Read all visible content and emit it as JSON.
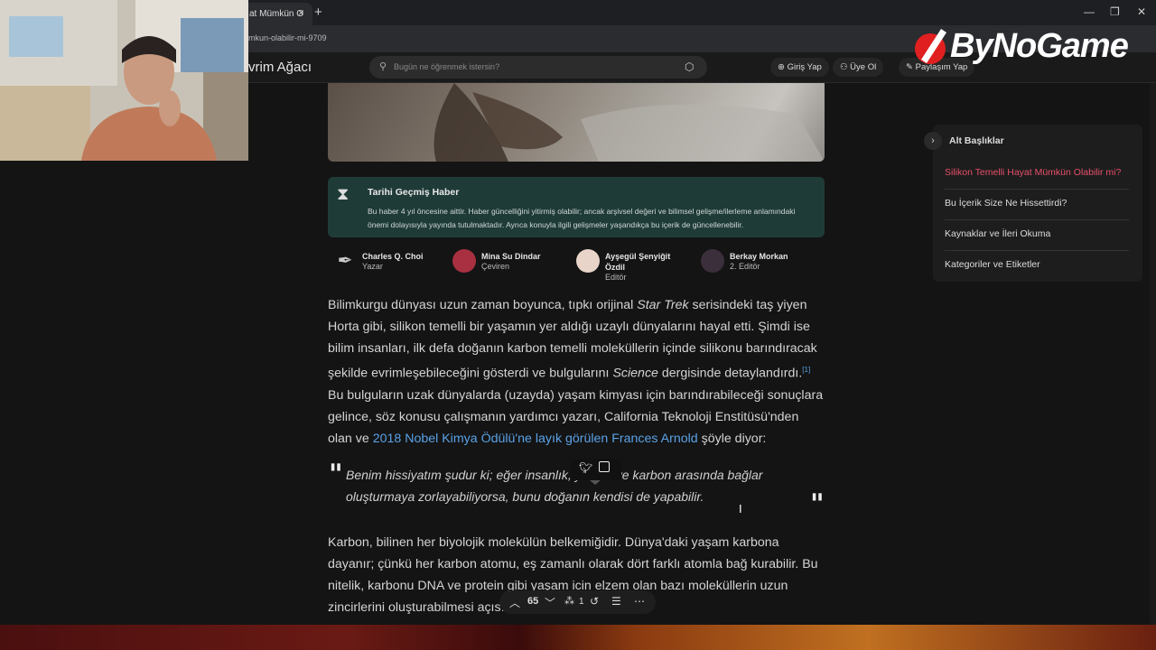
{
  "browser": {
    "tab_title": "at Mümkün O",
    "url": "mkun-olabilir-mi-9709",
    "new_tab_glyph": "+",
    "close_glyph": "×"
  },
  "watermark": {
    "text": "ByNoGame"
  },
  "site": {
    "brand": "vrim Ağacı",
    "search_placeholder": "Bugün ne öğrenmek istersin?",
    "nav": {
      "login": "Giriş Yap",
      "signup": "Üye Ol",
      "share": "Paylaşım Yap"
    }
  },
  "notice": {
    "title": "Tarihi Geçmiş Haber",
    "body": "Bu haber 4 yıl öncesine aittir. Haber güncelliğini yitirmiş olabilir; ancak arşivsel değeri ve bilimsel gelişme/ilerleme anlamındaki önemi dolayısıyla yayında tutulmaktadır. Ayrıca konuyla ilgili gelişmeler yaşandıkça bu içerik de güncellenebilir."
  },
  "authors": [
    {
      "name": "Charles Q. Choi",
      "role": "Yazar"
    },
    {
      "name": "Mina Su Dindar",
      "role": "Çeviren"
    },
    {
      "name": "Ayşegül Şenyiğit Özdil",
      "role": "Editör"
    },
    {
      "name": "Berkay Morkan",
      "role": "2. Editör"
    }
  ],
  "article": {
    "p1_a": "Bilimkurgu dünyası uzun zaman boyunca, tıpkı orijinal ",
    "p1_em1": "Star Trek",
    "p1_b": " serisindeki taş yiyen Horta gibi, silikon temelli bir yaşamın yer aldığı uzaylı dünyalarını hayal etti. Şimdi ise bilim insanları, ilk defa doğanın karbon temelli moleküllerin içinde silikonu barındıracak şekilde evrimleşebileceğini gösterdi ve bulgularını ",
    "p1_em2": "Science",
    "p1_c": " dergisinde detaylandırdı.",
    "p1_sup": "[1]",
    "p1_d": " Bu bulguların uzak dünyalarda (uzayda) yaşam kimyası için barındırabileceği sonuçlara gelince, söz konusu çalışmanın yardımcı yazarı, California Teknoloji Enstitüsü'nden olan ve ",
    "p1_link": "2018 Nobel Kimya Ödülü'ne layık görülen Frances Arnold",
    "p1_e": " şöyle diyor:",
    "quote": "Benim hissiyatım şudur ki; eğer insanlık, ya          kon ve karbon arasında bağlar oluşturmaya zorlayabiliyorsa, bunu doğanın kendisi de yapabilir.",
    "quote_open": "\"",
    "quote_close": "\"",
    "p2": "Karbon, bilinen her biyolojik molekülün belkemiğidir. Dünya'daki yaşam karbona dayanır; çünkü her karbon atomu, eş zamanlı olarak dört farklı atomla bağ kurabilir. Bu nitelik, karbonu DNA ve protein gibi yaşam icin elzem olan bazı moleküllerin uzun zincirlerini oluşturabilmesi açısından uygu"
  },
  "toc": {
    "title": "Alt Başlıklar",
    "items": [
      "Silikon Temelli Hayat Mümkün Olabilir mi?",
      "Bu İçerik Size Ne Hissettirdi?",
      "Kaynaklar ve İleri Okuma",
      "Kategoriler ve Etiketler"
    ],
    "active_color": "#e8506a"
  },
  "bottom_bar": {
    "votes": "65",
    "people": "1"
  },
  "colors": {
    "notice_bg": "#1f3b38",
    "link": "#5aa2e6"
  }
}
